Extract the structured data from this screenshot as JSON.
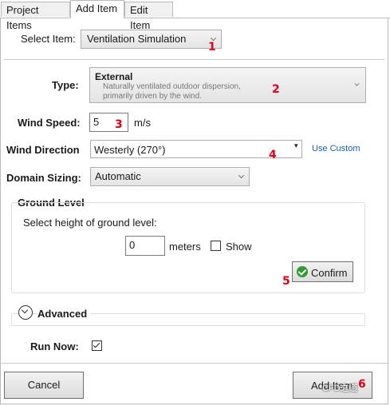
{
  "tabs": [
    "Project Items",
    "Add Item",
    "Edit Item"
  ],
  "select_item": {
    "label": "Select Item:",
    "value": "Ventilation Simulation",
    "marker": "1"
  },
  "type": {
    "label": "Type:",
    "title": "External",
    "desc1": "Naturally ventilated outdoor dispersion,",
    "desc2": "primarily driven by the wind.",
    "marker": "2"
  },
  "wind_speed": {
    "label": "Wind Speed:",
    "value": "5",
    "unit": "m/s",
    "marker": "3"
  },
  "wind_direction": {
    "label": "Wind Direction",
    "value": "Westerly (270°)",
    "marker": "4",
    "link": "Use Custom"
  },
  "domain_sizing": {
    "label": "Domain Sizing:",
    "value": "Automatic"
  },
  "ground_level": {
    "title": "Ground Level",
    "prompt": "Select height of ground level:",
    "value": "0",
    "unit": "meters",
    "show_label": "Show",
    "show_checked": false,
    "confirm_label": "Confirm",
    "marker": "5"
  },
  "advanced": {
    "label": "Advanced"
  },
  "run_now": {
    "label": "Run Now:",
    "checked": true
  },
  "footer": {
    "cancel_label": "Cancel",
    "add_label": "Add Item",
    "marker": "6",
    "watermark": "CFD之道"
  }
}
